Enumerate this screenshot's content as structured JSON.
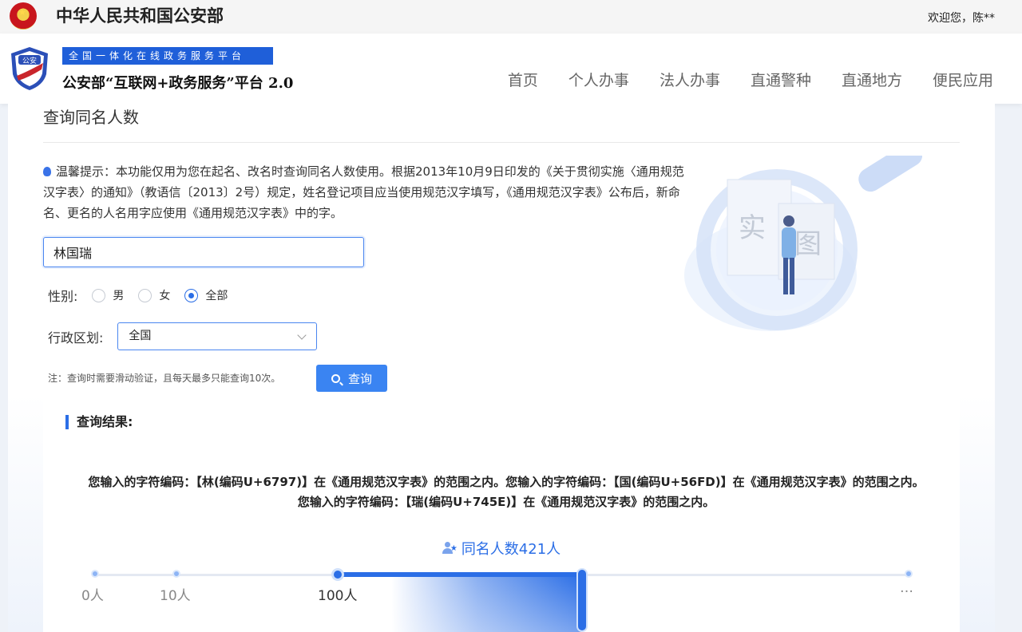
{
  "topbar": {
    "gov_name": "中华人民共和国公安部",
    "welcome": "欢迎您，陈**"
  },
  "header": {
    "badge_text": "公安",
    "platform_tag": "全国一体化在线政务服务平台",
    "platform_title": "公安部“互联网+政务服务”平台 2.0",
    "nav": [
      "首页",
      "个人办事",
      "法人办事",
      "直通警种",
      "直通地方",
      "便民应用"
    ]
  },
  "page": {
    "title": "查询同名人数",
    "tip": "温馨提示：本功能仅用为您在起名、改名时查询同名人数使用。根据2013年10月9日印发的《关于贯彻实施〈通用规范汉字表〉的通知》（教语信〔2013〕2号）规定，姓名登记项目应当使用规范汉字填写，《通用规范汉字表》公布后，新命名、更名的人名用字应使用《通用规范汉字表》中的字。"
  },
  "form": {
    "name_value": "林国瑞",
    "gender_label": "性别:",
    "gender_options": [
      "男",
      "女",
      "全部"
    ],
    "gender_selected": "全部",
    "region_label": "行政区划:",
    "region_value": "全国",
    "note": "注：查询时需要滑动验证，且每天最多只能查询10次。",
    "query_button": "查询"
  },
  "illustration": {
    "card_chars": [
      "实",
      "图"
    ]
  },
  "result": {
    "title": "查询结果:",
    "text": "您输入的字符编码：【林(编码U+6797)】在《通用规范汉字表》的范围之内。您输入的字符编码：【国(编码U+56FD)】在《通用规范汉字表》的范围之内。您输入的字符编码：【瑞(编码U+745E)】在《通用规范汉字表》的范围之内。",
    "count_text": "同名人数421人",
    "scale": [
      "0人",
      "10人",
      "100人",
      "…"
    ],
    "count": 421
  },
  "colors": {
    "primary": "#2b6ee6",
    "tag_blue": "#1f5fd9",
    "button": "#3a84f2"
  }
}
